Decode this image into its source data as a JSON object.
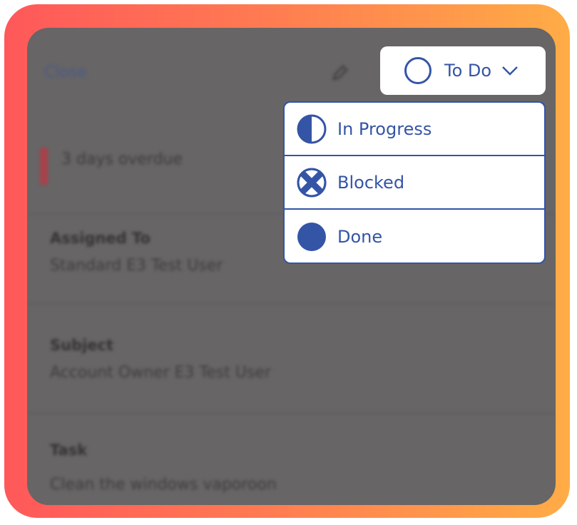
{
  "colors": {
    "accent": "#3454a6",
    "overlay": "#676566",
    "frame_start": "#ff585a",
    "frame_end": "#ffac46"
  },
  "backdrop": {
    "close_label": "Close",
    "overdue_text": "3 days overdue",
    "assigned_label": "Assigned To",
    "assigned_value": "Standard E3 Test User",
    "subject_label": "Subject",
    "subject_value": "Account Owner E3 Test User",
    "task_label": "Task",
    "task_value": "Clean the windows vaporoon"
  },
  "status_button": {
    "label": "To Do",
    "icon": "empty-circle-icon"
  },
  "status_menu": [
    {
      "label": "In Progress",
      "icon": "half-circle-icon"
    },
    {
      "label": "Blocked",
      "icon": "x-circle-icon"
    },
    {
      "label": "Done",
      "icon": "filled-circle-icon"
    }
  ]
}
